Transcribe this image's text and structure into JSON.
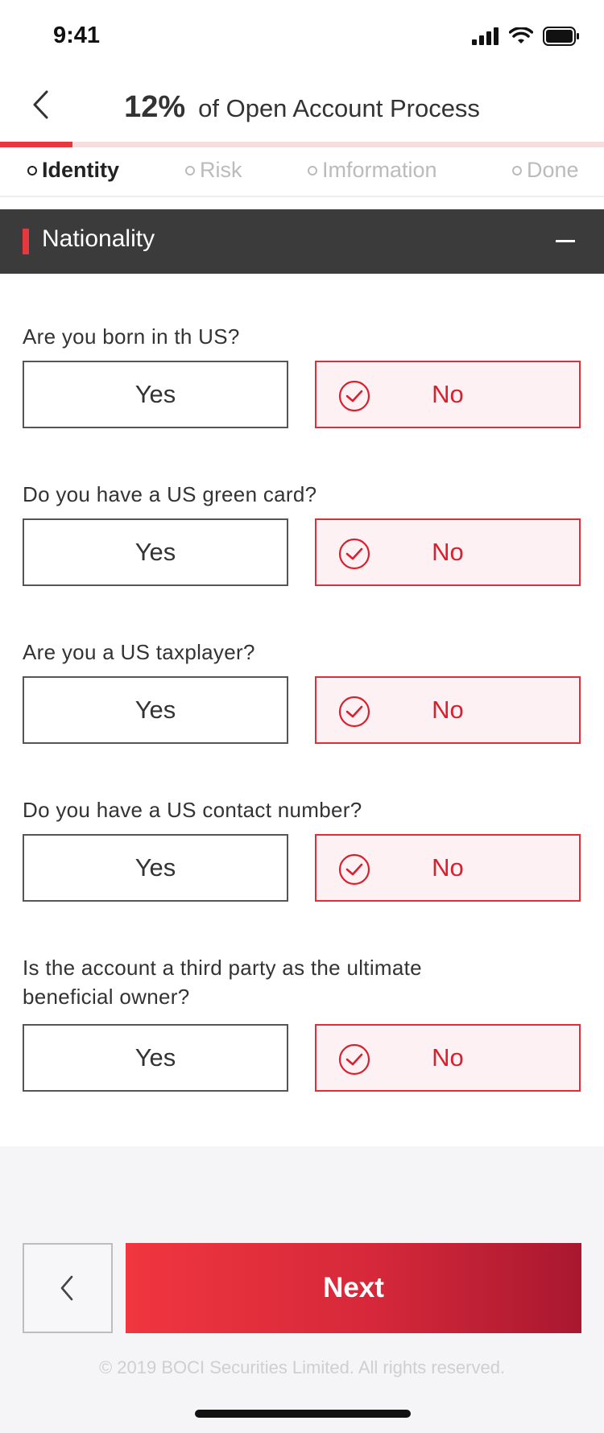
{
  "status_bar": {
    "time": "9:41"
  },
  "header": {
    "progress_value": "12%",
    "progress_label": "of Open Account Process",
    "progress_fraction": 0.12
  },
  "steps": [
    {
      "label": "Identity",
      "active": true
    },
    {
      "label": "Risk",
      "active": false
    },
    {
      "label": "Imformation",
      "active": false
    },
    {
      "label": "Done",
      "active": false
    }
  ],
  "section": {
    "title": "Nationality"
  },
  "questions": [
    {
      "text": "Are you born in th US?",
      "yes": "Yes",
      "no": "No",
      "selected": "no"
    },
    {
      "text": "Do you have a US green card?",
      "yes": "Yes",
      "no": "No",
      "selected": "no"
    },
    {
      "text": "Are you a US taxplayer?",
      "yes": "Yes",
      "no": "No",
      "selected": "no"
    },
    {
      "text": "Do you have a US contact number?",
      "yes": "Yes",
      "no": "No",
      "selected": "no"
    },
    {
      "text": "Is the account a third party as the ultimate beneficial owner?",
      "yes": "Yes",
      "no": "No",
      "selected": "no"
    }
  ],
  "footer": {
    "next_label": "Next",
    "copyright": "© 2019 BOCI Securities Limited. All rights reserved."
  },
  "colors": {
    "accent": "#e8383f",
    "selected_text": "#d8202e",
    "section_bg": "#3b3b3b"
  }
}
